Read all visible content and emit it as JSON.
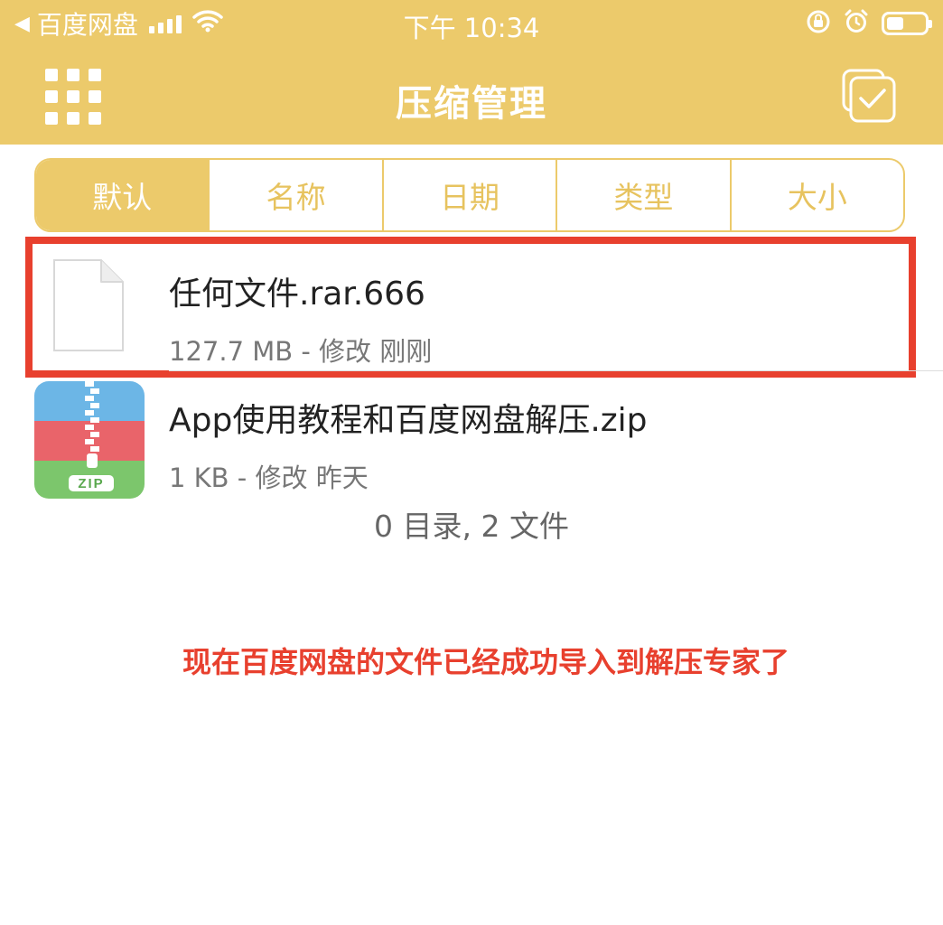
{
  "status_bar": {
    "back_app": "百度网盘",
    "time": "下午 10:34",
    "icons": [
      "back-arrow-icon",
      "signal-icon",
      "wifi-icon",
      "rotation-lock-icon",
      "alarm-icon",
      "battery-icon"
    ]
  },
  "nav": {
    "title": "压缩管理",
    "left_icon": "grid-menu-icon",
    "right_icon": "select-checkbox-icon"
  },
  "sort_tabs": [
    {
      "label": "默认",
      "active": true
    },
    {
      "label": "名称",
      "active": false
    },
    {
      "label": "日期",
      "active": false
    },
    {
      "label": "类型",
      "active": false
    },
    {
      "label": "大小",
      "active": false
    }
  ],
  "files": [
    {
      "name": "任何文件.rar.666",
      "meta": "127.7 MB - 修改 刚刚",
      "icon": "generic-file-icon"
    },
    {
      "name": "App使用教程和百度网盘解压.zip",
      "meta": "1 KB - 修改 昨天",
      "icon": "zip-file-icon"
    }
  ],
  "summary": "0 目录, 2 文件",
  "annotation": "现在百度网盘的文件已经成功导入到解压专家了",
  "colors": {
    "accent": "#ecca6b",
    "highlight": "#e8402e",
    "text_primary": "#222222",
    "text_secondary": "#777777"
  }
}
